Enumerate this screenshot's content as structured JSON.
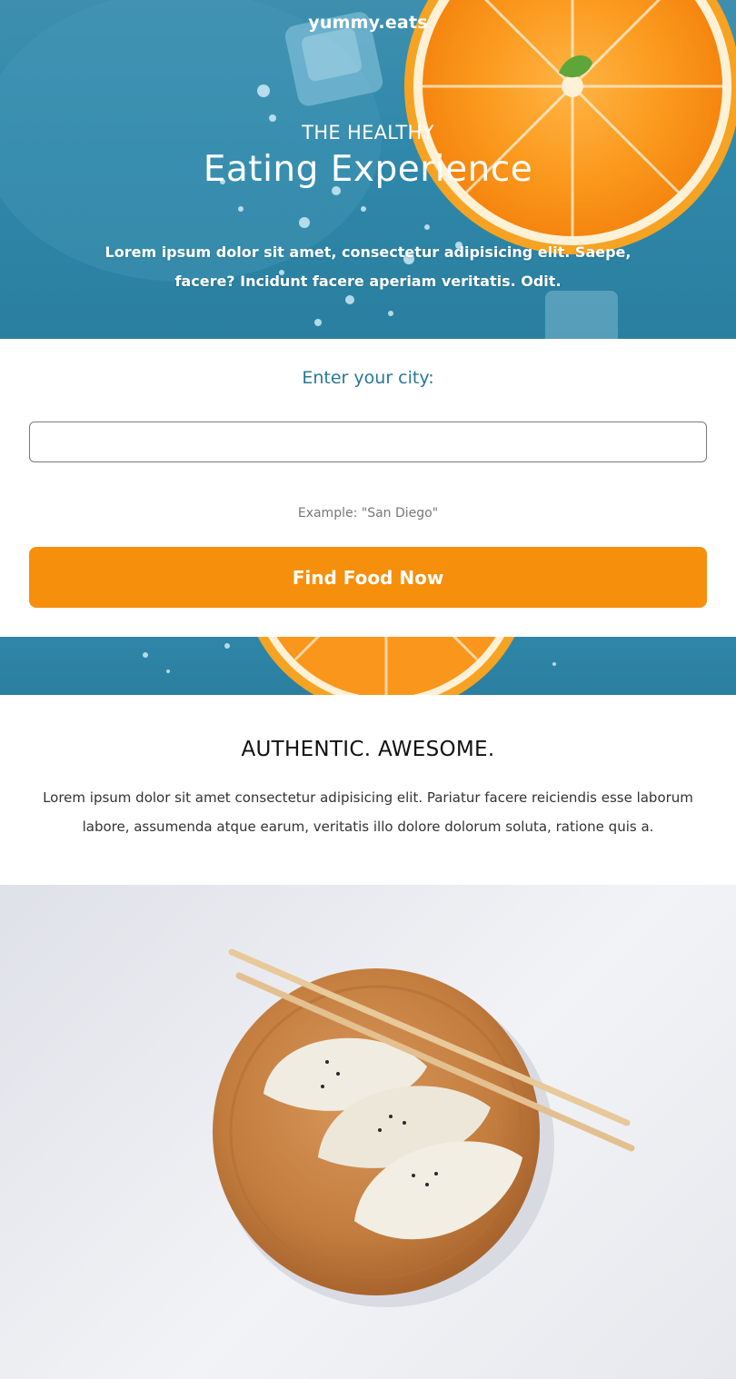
{
  "brand": {
    "name": "yummy.eats"
  },
  "hero": {
    "eyebrow": "THE HEALTHY",
    "title": "Eating Experience",
    "text": "Lorem ipsum dolor sit amet, consectetur adipisicing elit. Saepe, facere? Incidunt facere aperiam veritatis. Odit."
  },
  "search": {
    "label": "Enter your city:",
    "value": "",
    "placeholder": "",
    "hint": "Example: \"San Diego\"",
    "button_label": "Find Food Now"
  },
  "about": {
    "title": "AUTHENTIC. AWESOME.",
    "text": "Lorem ipsum dolor sit amet consectetur adipisicing elit. Pariatur facere reiciendis esse laborum labore, assumenda atque earum, veritatis illo dolore dolorum soluta, ratione quis a."
  },
  "images": {
    "hero": "orange-slice-water-photo",
    "strip": "orange-slice-photo-strip",
    "food": "dumplings-on-wooden-plate-photo"
  },
  "colors": {
    "hero_blue": "#2f88aa",
    "accent_blue": "#1ab2ee",
    "label_blue": "#277899",
    "button_orange": "#f68f0c"
  }
}
